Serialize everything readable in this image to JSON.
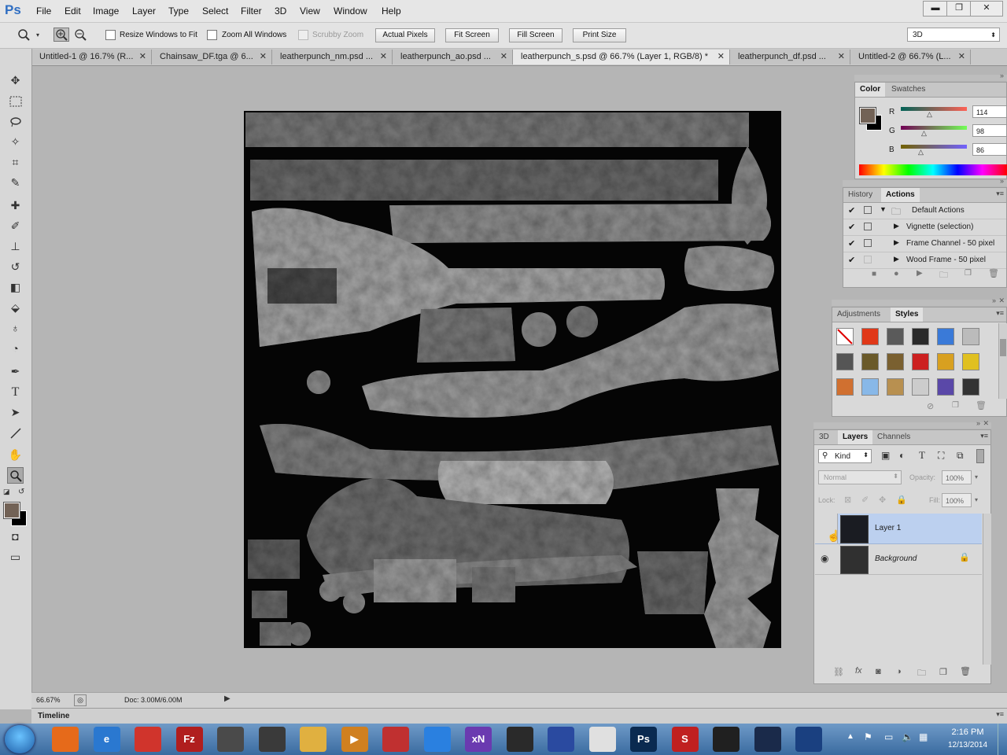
{
  "app": {
    "logo": "Ps"
  },
  "menu": [
    "File",
    "Edit",
    "Image",
    "Layer",
    "Type",
    "Select",
    "Filter",
    "3D",
    "View",
    "Window",
    "Help"
  ],
  "window_controls": {
    "minimize": "▬",
    "restore": "❐",
    "close": "✕"
  },
  "options_bar": {
    "resize_windows_label": "Resize Windows to Fit",
    "zoom_all_label": "Zoom All Windows",
    "scrubby_zoom_label": "Scrubby Zoom",
    "actual_pixels": "Actual Pixels",
    "fit_screen": "Fit Screen",
    "fill_screen": "Fill Screen",
    "print_size": "Print Size",
    "workspace": "3D"
  },
  "tabs": [
    {
      "label": "Untitled-1 @ 16.7% (R...",
      "active": false
    },
    {
      "label": "Chainsaw_DF.tga @ 6...",
      "active": false
    },
    {
      "label": "leatherpunch_nm.psd ...",
      "active": false
    },
    {
      "label": "leatherpunch_ao.psd ...",
      "active": false
    },
    {
      "label": "leatherpunch_s.psd @ 66.7% (Layer 1, RGB/8) *",
      "active": true
    },
    {
      "label": "leatherpunch_df.psd ...",
      "active": false
    },
    {
      "label": "Untitled-2 @ 66.7% (L...",
      "active": false
    }
  ],
  "color_panel": {
    "tabs": [
      "Color",
      "Swatches"
    ],
    "r_label": "R",
    "g_label": "G",
    "b_label": "B",
    "r": "114",
    "g": "98",
    "b": "86",
    "fg_color": "#726256"
  },
  "history_panel": {
    "tabs": [
      "History",
      "Actions"
    ],
    "actions": [
      {
        "label": "Default Actions"
      },
      {
        "label": "Vignette (selection)"
      },
      {
        "label": "Frame Channel - 50 pixel"
      },
      {
        "label": "Wood Frame - 50 pixel"
      }
    ]
  },
  "adjustments_panel": {
    "tabs": [
      "Adjustments",
      "Styles"
    ],
    "swatch_colors": [
      "#ffffff",
      "#e03818",
      "#5a5a5a",
      "#2a2a2a",
      "#3a7ad8",
      "#bbbbbb",
      "#555555",
      "#6a5a2a",
      "#7a6030",
      "#cc2020",
      "#d8a020",
      "#e0c020",
      "#d07030",
      "#88b8e8",
      "#b89050",
      "#cccccc",
      "#5a48a8",
      "#333333"
    ]
  },
  "layers_panel": {
    "tabs": [
      "3D",
      "Layers",
      "Channels"
    ],
    "kind": "Kind",
    "blend_mode": "Normal",
    "opacity_label": "Opacity:",
    "opacity": "100%",
    "lock_label": "Lock:",
    "fill_label": "Fill:",
    "fill": "100%",
    "layers": [
      {
        "name": "Layer 1",
        "selected": true,
        "visible": false
      },
      {
        "name": "Background",
        "selected": false,
        "visible": true
      }
    ]
  },
  "status": {
    "zoom": "66.67%",
    "doc": "Doc: 3.00M/6.00M"
  },
  "timeline_label": "Timeline",
  "taskbar": {
    "time": "2:16 PM",
    "date": "12/13/2014",
    "apps": [
      {
        "label": "",
        "color": "#e66a1a"
      },
      {
        "label": "e",
        "color": "#2a78d0"
      },
      {
        "label": "",
        "color": "#d0342c"
      },
      {
        "label": "Fz",
        "color": "#b01e1e"
      },
      {
        "label": "",
        "color": "#4a4a4a"
      },
      {
        "label": "",
        "color": "#3a3a3a"
      },
      {
        "label": "",
        "color": "#e0b040"
      },
      {
        "label": "▶",
        "color": "#d08020"
      },
      {
        "label": "",
        "color": "#c03030"
      },
      {
        "label": "",
        "color": "#2a80e0"
      },
      {
        "label": "xN",
        "color": "#6a3ab0"
      },
      {
        "label": "",
        "color": "#2a2a2a"
      },
      {
        "label": "",
        "color": "#2a4aa0"
      },
      {
        "label": "",
        "color": "#e0e0e0"
      },
      {
        "label": "Ps",
        "color": "#0a2a50"
      },
      {
        "label": "S",
        "color": "#c02020"
      },
      {
        "label": "",
        "color": "#202020"
      },
      {
        "label": "",
        "color": "#1a2a4a"
      },
      {
        "label": "",
        "color": "#1a4080"
      }
    ]
  }
}
